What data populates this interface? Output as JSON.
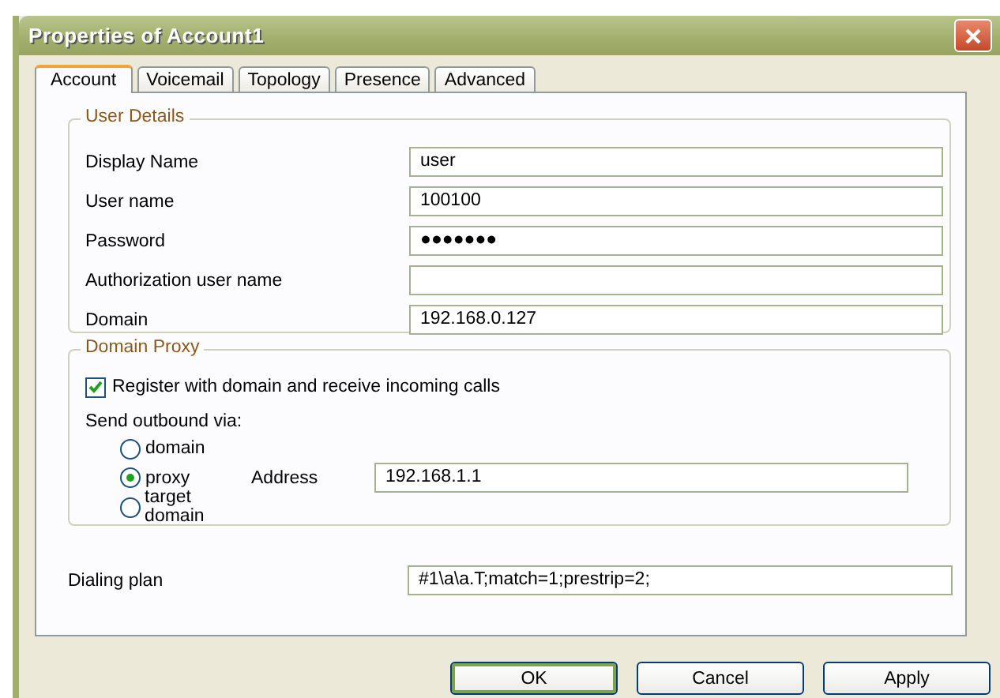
{
  "window": {
    "title": "Properties of Account1"
  },
  "tabs": [
    {
      "label": "Account",
      "selected": true
    },
    {
      "label": "Voicemail",
      "selected": false
    },
    {
      "label": "Topology",
      "selected": false
    },
    {
      "label": "Presence",
      "selected": false
    },
    {
      "label": "Advanced",
      "selected": false
    }
  ],
  "user_details": {
    "title": "User Details",
    "fields": [
      {
        "label": "Display Name",
        "value": "user"
      },
      {
        "label": "User name",
        "value": "100100"
      },
      {
        "label": "Password",
        "value": "●●●●●●●"
      },
      {
        "label": "Authorization user name"
      },
      {
        "label": "Domain",
        "value": "192.168.0.127"
      }
    ]
  },
  "domain_proxy": {
    "title": "Domain Proxy",
    "register": {
      "label": "Register with domain and receive incoming calls",
      "checked": true
    },
    "outbound_label": "Send outbound via:",
    "options": [
      {
        "label": "domain",
        "selected": false
      },
      {
        "label": "proxy",
        "selected": true
      },
      {
        "label": "target domain",
        "selected": false
      }
    ],
    "address": {
      "label": "Address",
      "value": "192.168.1.1"
    }
  },
  "dialing_plan": {
    "label": "Dialing plan",
    "value": "#1\\a\\a.T;match=1;prestrip=2;"
  },
  "buttons": [
    {
      "label": "OK",
      "default": true
    },
    {
      "label": "Cancel",
      "default": false
    },
    {
      "label": "Apply",
      "default": false
    }
  ]
}
